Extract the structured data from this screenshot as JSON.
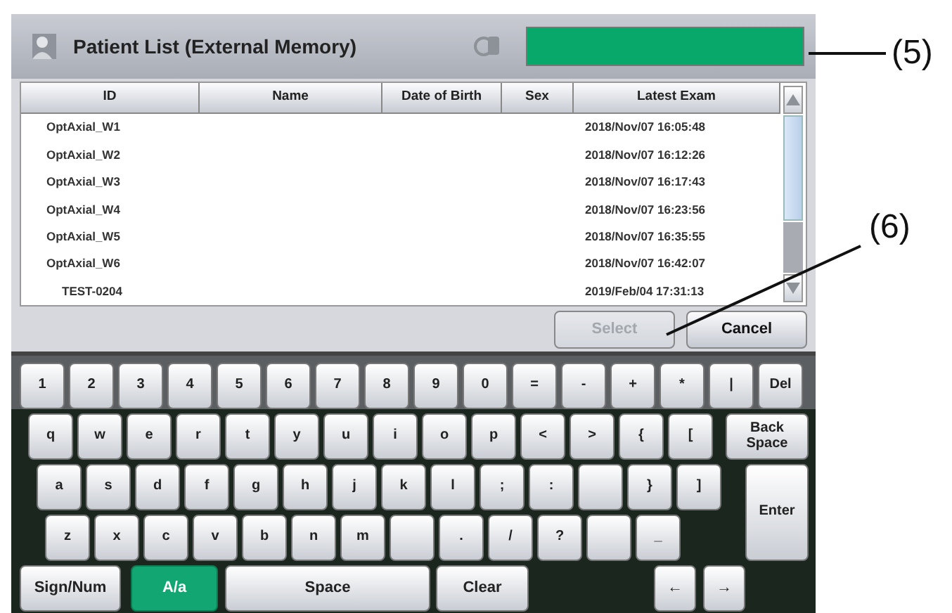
{
  "window": {
    "title": "Patient List (External Memory)"
  },
  "table": {
    "columns": [
      "ID",
      "Name",
      "Date of Birth",
      "Sex",
      "Latest Exam"
    ],
    "rows": [
      {
        "id": "OptAxial_W1",
        "latest_exam": "2018/Nov/07 16:05:48"
      },
      {
        "id": "OptAxial_W2",
        "latest_exam": "2018/Nov/07 16:12:26"
      },
      {
        "id": "OptAxial_W3",
        "latest_exam": "2018/Nov/07 16:17:43"
      },
      {
        "id": "OptAxial_W4",
        "latest_exam": "2018/Nov/07 16:23:56"
      },
      {
        "id": "OptAxial_W5",
        "latest_exam": "2018/Nov/07 16:35:55"
      },
      {
        "id": "OptAxial_W6",
        "latest_exam": "2018/Nov/07 16:42:07"
      },
      {
        "id": "TEST-0204",
        "latest_exam": "2019/Feb/04 17:31:13"
      }
    ]
  },
  "buttons": [
    {
      "label": "Select",
      "disabled": true
    },
    {
      "label": "Cancel",
      "disabled": false
    }
  ],
  "keyboard": {
    "rows": [
      [
        {
          "kind": "key",
          "label": "1"
        },
        {
          "kind": "key",
          "label": "2"
        },
        {
          "kind": "key",
          "label": "3"
        },
        {
          "kind": "key",
          "label": "4"
        },
        {
          "kind": "key",
          "label": "5"
        },
        {
          "kind": "key",
          "label": "6"
        },
        {
          "kind": "key",
          "label": "7"
        },
        {
          "kind": "key",
          "label": "8"
        },
        {
          "kind": "key",
          "label": "9"
        },
        {
          "kind": "key",
          "label": "0"
        },
        {
          "kind": "key",
          "label": "="
        },
        {
          "kind": "key",
          "label": "-"
        },
        {
          "kind": "key",
          "label": "+"
        },
        {
          "kind": "key",
          "label": "*"
        },
        {
          "kind": "key",
          "label": "|"
        },
        {
          "kind": "key",
          "label": "Del"
        }
      ],
      [
        {
          "kind": "key",
          "label": "q"
        },
        {
          "kind": "key",
          "label": "w"
        },
        {
          "kind": "key",
          "label": "e"
        },
        {
          "kind": "key",
          "label": "r"
        },
        {
          "kind": "key",
          "label": "t"
        },
        {
          "kind": "key",
          "label": "y"
        },
        {
          "kind": "key",
          "label": "u"
        },
        {
          "kind": "key",
          "label": "i"
        },
        {
          "kind": "key",
          "label": "o"
        },
        {
          "kind": "key",
          "label": "p"
        },
        {
          "kind": "key",
          "label": "<"
        },
        {
          "kind": "key",
          "label": ">"
        },
        {
          "kind": "key",
          "label": "{"
        },
        {
          "kind": "key",
          "label": "["
        },
        {
          "kind": "wide",
          "label": "Back Space"
        }
      ],
      [
        {
          "kind": "key",
          "label": "a"
        },
        {
          "kind": "key",
          "label": "s"
        },
        {
          "kind": "key",
          "label": "d"
        },
        {
          "kind": "key",
          "label": "f"
        },
        {
          "kind": "key",
          "label": "g"
        },
        {
          "kind": "key",
          "label": "h"
        },
        {
          "kind": "key",
          "label": "j"
        },
        {
          "kind": "key",
          "label": "k"
        },
        {
          "kind": "key",
          "label": "l"
        },
        {
          "kind": "key",
          "label": ";"
        },
        {
          "kind": "key",
          "label": ":"
        },
        {
          "kind": "blank"
        },
        {
          "kind": "key",
          "label": "}"
        },
        {
          "kind": "key",
          "label": "]"
        },
        {
          "kind": "tall",
          "label": "Enter"
        }
      ],
      [
        {
          "kind": "key",
          "label": "z"
        },
        {
          "kind": "key",
          "label": "x"
        },
        {
          "kind": "key",
          "label": "c"
        },
        {
          "kind": "key",
          "label": "v"
        },
        {
          "kind": "key",
          "label": "b"
        },
        {
          "kind": "key",
          "label": "n"
        },
        {
          "kind": "key",
          "label": "m"
        },
        {
          "kind": "blank"
        },
        {
          "kind": "key",
          "label": "."
        },
        {
          "kind": "key",
          "label": "/"
        },
        {
          "kind": "key",
          "label": "?"
        },
        {
          "kind": "blank"
        },
        {
          "kind": "key",
          "label": "_"
        }
      ]
    ],
    "bottom": [
      {
        "label": "Sign/Num",
        "selected": false
      },
      {
        "label": "A/a",
        "selected": true
      },
      {
        "label": "Space",
        "selected": false
      },
      {
        "label": "Clear",
        "selected": false
      },
      {
        "label": "←",
        "selected": false
      },
      {
        "label": "→",
        "selected": false
      }
    ]
  },
  "callouts": [
    {
      "label": "(5)"
    },
    {
      "label": "(6)"
    }
  ]
}
